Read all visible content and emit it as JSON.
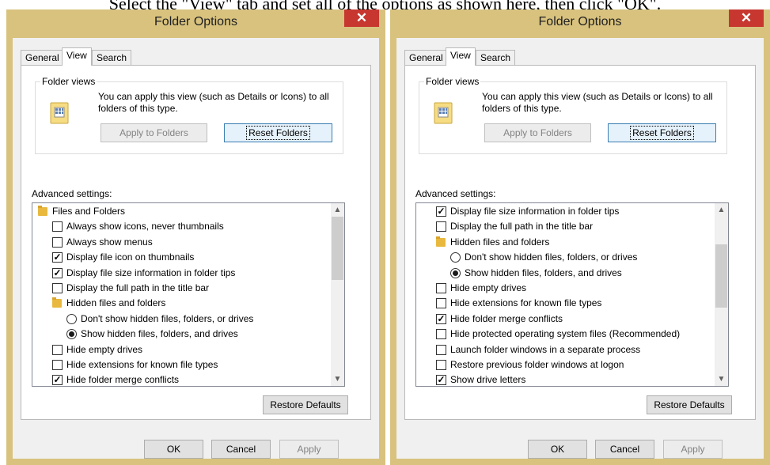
{
  "caption": "Select the \"View\" tab and set all of the options as shown here, then click \"OK\".",
  "accent_colors": {
    "close_button": "#c7372f",
    "frame": "#d8c27e",
    "folder": "#e8b93e"
  },
  "dialogs": [
    {
      "title": "Folder Options",
      "close_icon": "close-icon",
      "tabs": [
        {
          "label": "General"
        },
        {
          "label": "View",
          "active": true
        },
        {
          "label": "Search"
        }
      ],
      "folder_views": {
        "label": "Folder views",
        "icon": "folder-view-icon",
        "description": "You can apply this view (such as Details or Icons) to all folders of this type.",
        "apply_button": "Apply to Folders",
        "reset_button": "Reset Folders"
      },
      "advanced_label": "Advanced settings:",
      "scroll_fraction": 0.0,
      "items": [
        {
          "type": "folder",
          "label": "Files and Folders",
          "indent": 0,
          "icon": "folder-icon"
        },
        {
          "type": "checkbox",
          "label": "Always show icons, never thumbnails",
          "checked": false,
          "indent": 1
        },
        {
          "type": "checkbox",
          "label": "Always show menus",
          "checked": false,
          "indent": 1
        },
        {
          "type": "checkbox",
          "label": "Display file icon on thumbnails",
          "checked": true,
          "indent": 1
        },
        {
          "type": "checkbox",
          "label": "Display file size information in folder tips",
          "checked": true,
          "indent": 1
        },
        {
          "type": "checkbox",
          "label": "Display the full path in the title bar",
          "checked": false,
          "indent": 1
        },
        {
          "type": "folder",
          "label": "Hidden files and folders",
          "indent": 1,
          "icon": "folder-icon"
        },
        {
          "type": "radio",
          "label": "Don't show hidden files, folders, or drives",
          "checked": false,
          "indent": 2
        },
        {
          "type": "radio",
          "label": "Show hidden files, folders, and drives",
          "checked": true,
          "indent": 2
        },
        {
          "type": "checkbox",
          "label": "Hide empty drives",
          "checked": false,
          "indent": 1
        },
        {
          "type": "checkbox",
          "label": "Hide extensions for known file types",
          "checked": false,
          "indent": 1
        },
        {
          "type": "checkbox",
          "label": "Hide folder merge conflicts",
          "checked": true,
          "indent": 1
        }
      ],
      "restore_button": "Restore Defaults",
      "ok_button": "OK",
      "cancel_button": "Cancel",
      "apply_button": "Apply"
    },
    {
      "title": "Folder Options",
      "close_icon": "close-icon",
      "tabs": [
        {
          "label": "General"
        },
        {
          "label": "View",
          "active": true
        },
        {
          "label": "Search"
        }
      ],
      "folder_views": {
        "label": "Folder views",
        "icon": "folder-view-icon",
        "description": "You can apply this view (such as Details or Icons) to all folders of this type.",
        "apply_button": "Apply to Folders",
        "reset_button": "Reset Folders"
      },
      "advanced_label": "Advanced settings:",
      "scroll_fraction": 0.3,
      "items": [
        {
          "type": "checkbox",
          "label": "Display file size information in folder tips",
          "checked": true,
          "indent": 1
        },
        {
          "type": "checkbox",
          "label": "Display the full path in the title bar",
          "checked": false,
          "indent": 1
        },
        {
          "type": "folder",
          "label": "Hidden files and folders",
          "indent": 1,
          "icon": "folder-icon"
        },
        {
          "type": "radio",
          "label": "Don't show hidden files, folders, or drives",
          "checked": false,
          "indent": 2
        },
        {
          "type": "radio",
          "label": "Show hidden files, folders, and drives",
          "checked": true,
          "indent": 2
        },
        {
          "type": "checkbox",
          "label": "Hide empty drives",
          "checked": false,
          "indent": 1
        },
        {
          "type": "checkbox",
          "label": "Hide extensions for known file types",
          "checked": false,
          "indent": 1
        },
        {
          "type": "checkbox",
          "label": "Hide folder merge conflicts",
          "checked": true,
          "indent": 1
        },
        {
          "type": "checkbox",
          "label": "Hide protected operating system files (Recommended)",
          "checked": false,
          "indent": 1
        },
        {
          "type": "checkbox",
          "label": "Launch folder windows in a separate process",
          "checked": false,
          "indent": 1
        },
        {
          "type": "checkbox",
          "label": "Restore previous folder windows at logon",
          "checked": false,
          "indent": 1
        },
        {
          "type": "checkbox",
          "label": "Show drive letters",
          "checked": true,
          "indent": 1
        }
      ],
      "restore_button": "Restore Defaults",
      "ok_button": "OK",
      "cancel_button": "Cancel",
      "apply_button": "Apply"
    }
  ]
}
